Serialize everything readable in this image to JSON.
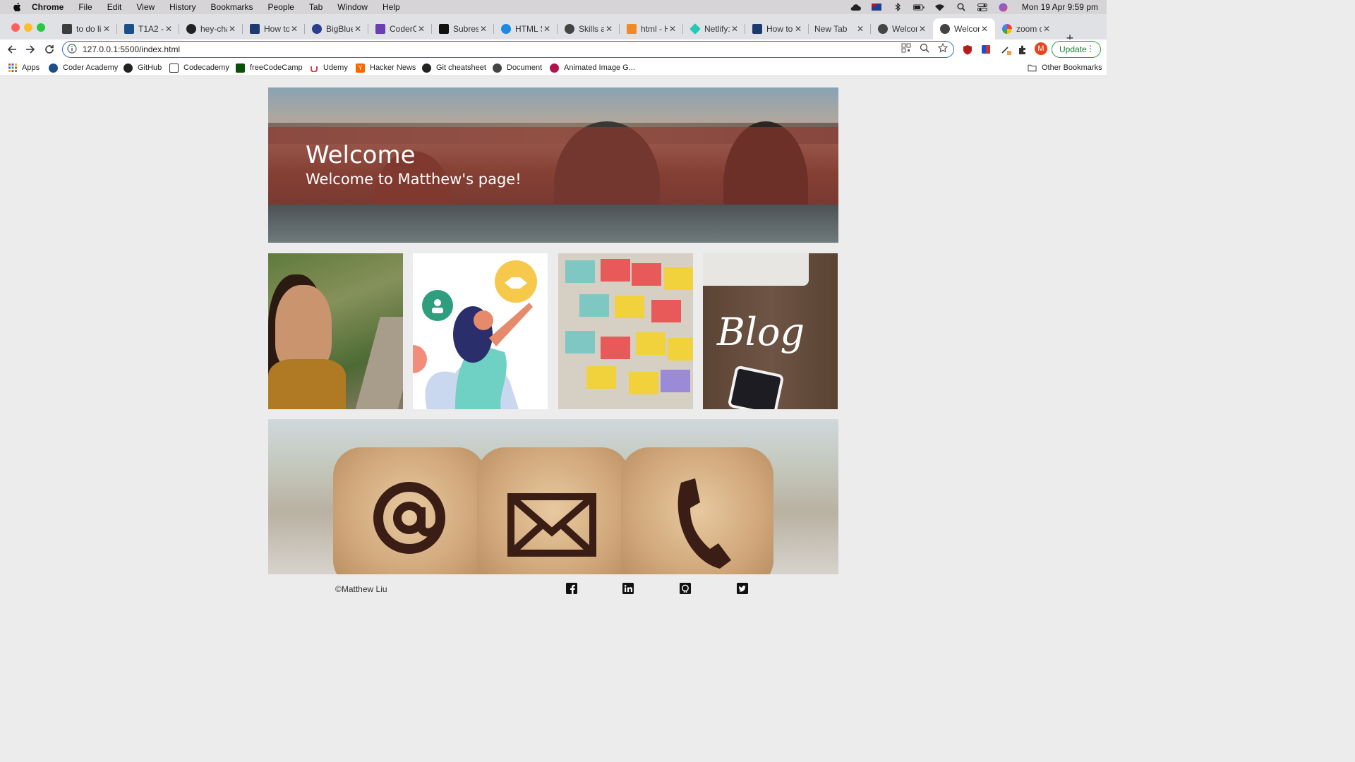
{
  "menubar": {
    "app": "Chrome",
    "items": [
      "File",
      "Edit",
      "View",
      "History",
      "Bookmarks",
      "People",
      "Tab",
      "Window",
      "Help"
    ],
    "clock": "Mon 19 Apr  9:59 pm"
  },
  "tabs": [
    {
      "label": "to do lis",
      "active": false
    },
    {
      "label": "T1A2 - I",
      "active": false
    },
    {
      "label": "hey-cha",
      "active": false
    },
    {
      "label": "How to",
      "active": false
    },
    {
      "label": "BigBlue",
      "active": false
    },
    {
      "label": "CoderC",
      "active": false
    },
    {
      "label": "Subres",
      "active": false
    },
    {
      "label": "HTML S",
      "active": false
    },
    {
      "label": "Skills ar",
      "active": false
    },
    {
      "label": "html - H",
      "active": false
    },
    {
      "label": "Netlify:",
      "active": false
    },
    {
      "label": "How to",
      "active": false
    },
    {
      "label": "New Tab",
      "active": false
    },
    {
      "label": "Welcon",
      "active": false
    },
    {
      "label": "Welcon",
      "active": true
    },
    {
      "label": "zoom o",
      "active": false
    }
  ],
  "toolbar": {
    "url": "127.0.0.1:5500/index.html",
    "profile_initial": "M",
    "update_label": "Update"
  },
  "bookmarks": {
    "items": [
      "Apps",
      "Coder Academy",
      "GitHub",
      "Codecademy",
      "freeCodeCamp",
      "Udemy",
      "Hacker News",
      "Git cheatsheet",
      "Document",
      "Animated Image G..."
    ],
    "other": "Other Bookmarks"
  },
  "hero": {
    "title": "Welcome",
    "subtitle": "Welcome to Matthew's page!"
  },
  "tiles": {
    "blog_word": "Blog"
  },
  "footer": {
    "copyright": "©Matthew Liu",
    "social": [
      "facebook",
      "linkedin",
      "github",
      "twitter"
    ]
  },
  "colors": {
    "accent": "#2f6fd8",
    "update_green": "#1a7f37",
    "hero_band": "#963729"
  }
}
